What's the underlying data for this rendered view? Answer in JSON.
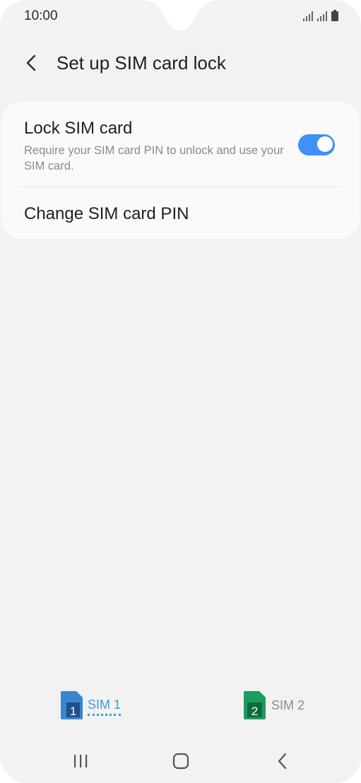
{
  "status_bar": {
    "time": "10:00"
  },
  "header": {
    "back_icon": "chevron-left-icon",
    "title": "Set up SIM card lock"
  },
  "settings": {
    "lock_sim": {
      "title": "Lock SIM card",
      "description": "Require your SIM card PIN to unlock and use your SIM card.",
      "toggle_on": true
    },
    "change_pin": {
      "label": "Change SIM card PIN"
    }
  },
  "sim_tabs": [
    {
      "badge": "1",
      "label": "SIM 1",
      "selected": true,
      "color": "#3a85d0"
    },
    {
      "badge": "2",
      "label": "SIM 2",
      "selected": false,
      "color": "#1a9d5f"
    }
  ],
  "colors": {
    "accent": "#3e91f7",
    "sim1": "#3a85d0",
    "sim2": "#1a9d5f"
  },
  "nav_bar": {
    "recents_icon": "recents-icon",
    "home_icon": "home-icon",
    "back_icon": "back-icon"
  }
}
